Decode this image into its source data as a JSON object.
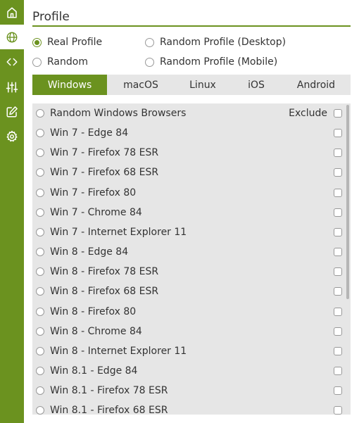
{
  "sidebar": {
    "items": [
      {
        "icon": "home-icon"
      },
      {
        "icon": "globe-icon",
        "active": true
      },
      {
        "icon": "code-icon"
      },
      {
        "icon": "sliders-icon"
      },
      {
        "icon": "edit-icon"
      },
      {
        "icon": "gear-icon"
      }
    ]
  },
  "page": {
    "title": "Profile"
  },
  "profile_options": {
    "real": "Real Profile",
    "random_desktop": "Random Profile (Desktop)",
    "random": "Random",
    "random_mobile": "Random Profile (Mobile)",
    "selected": "real"
  },
  "tabs": {
    "windows": "Windows",
    "macos": "macOS",
    "linux": "Linux",
    "ios": "iOS",
    "android": "Android",
    "active": "windows"
  },
  "list": {
    "exclude_label": "Exclude",
    "rows": [
      "Random Windows Browsers",
      "Win 7 - Edge 84",
      "Win 7 - Firefox 78 ESR",
      "Win 7 - Firefox 68 ESR",
      "Win 7 - Firefox 80",
      "Win 7 - Chrome 84",
      "Win 7 - Internet Explorer 11",
      "Win 8 - Edge 84",
      "Win 8 - Firefox 78 ESR",
      "Win 8 - Firefox 68 ESR",
      "Win 8 - Firefox 80",
      "Win 8 - Chrome 84",
      "Win 8 - Internet Explorer 11",
      "Win 8.1 - Edge 84",
      "Win 8.1 - Firefox 78 ESR",
      "Win 8.1 - Firefox 68 ESR"
    ]
  },
  "colors": {
    "accent": "#6b921f",
    "panel_bg": "#e6e6e6"
  }
}
